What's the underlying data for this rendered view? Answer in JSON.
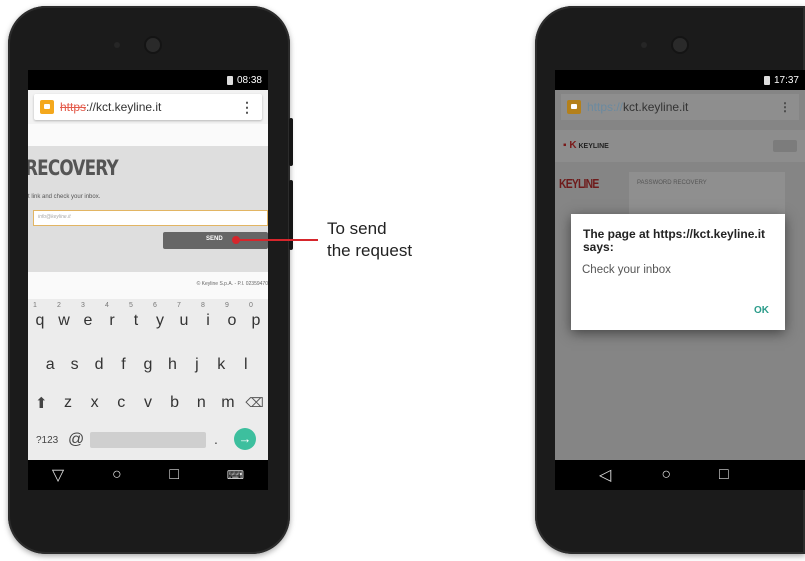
{
  "annotation": {
    "line1": "To send",
    "line2": "the request"
  },
  "left_phone": {
    "status_time": "08:38",
    "url_strike": "https",
    "url_rest": "://kct.keyline.it",
    "heading": "RECOVERY",
    "instruction": "t link and check your inbox.",
    "email_placeholder": "info@keyline.it",
    "send_label": "SEND",
    "footer": "© Keyline S.p.A. - P.I. 02359470",
    "keyboard": {
      "row1": [
        "q",
        "w",
        "e",
        "r",
        "t",
        "y",
        "u",
        "i",
        "o",
        "p"
      ],
      "row1_nums": [
        "1",
        "2",
        "3",
        "4",
        "5",
        "6",
        "7",
        "8",
        "9",
        "0"
      ],
      "row2": [
        "a",
        "s",
        "d",
        "f",
        "g",
        "h",
        "j",
        "k",
        "l"
      ],
      "row3": [
        "z",
        "x",
        "c",
        "v",
        "b",
        "n",
        "m"
      ],
      "sym_label": "?123",
      "at_label": "@",
      "dot_label": "."
    }
  },
  "right_phone": {
    "status_time": "17:37",
    "url_proto": "https://",
    "url_rest": "kct.keyline.it",
    "logo_text": "KEYLINE",
    "brand_side": "KEYLINE",
    "card_title": "PASSWORD RECOVERY",
    "dialog_title": "The page at https://kct.keyline.it says:",
    "dialog_message": "Check your inbox",
    "dialog_ok": "OK"
  },
  "colors": {
    "accent_red": "#d6262c",
    "lock_orange": "#f4a81d",
    "enter_green": "#3dbf9e"
  }
}
